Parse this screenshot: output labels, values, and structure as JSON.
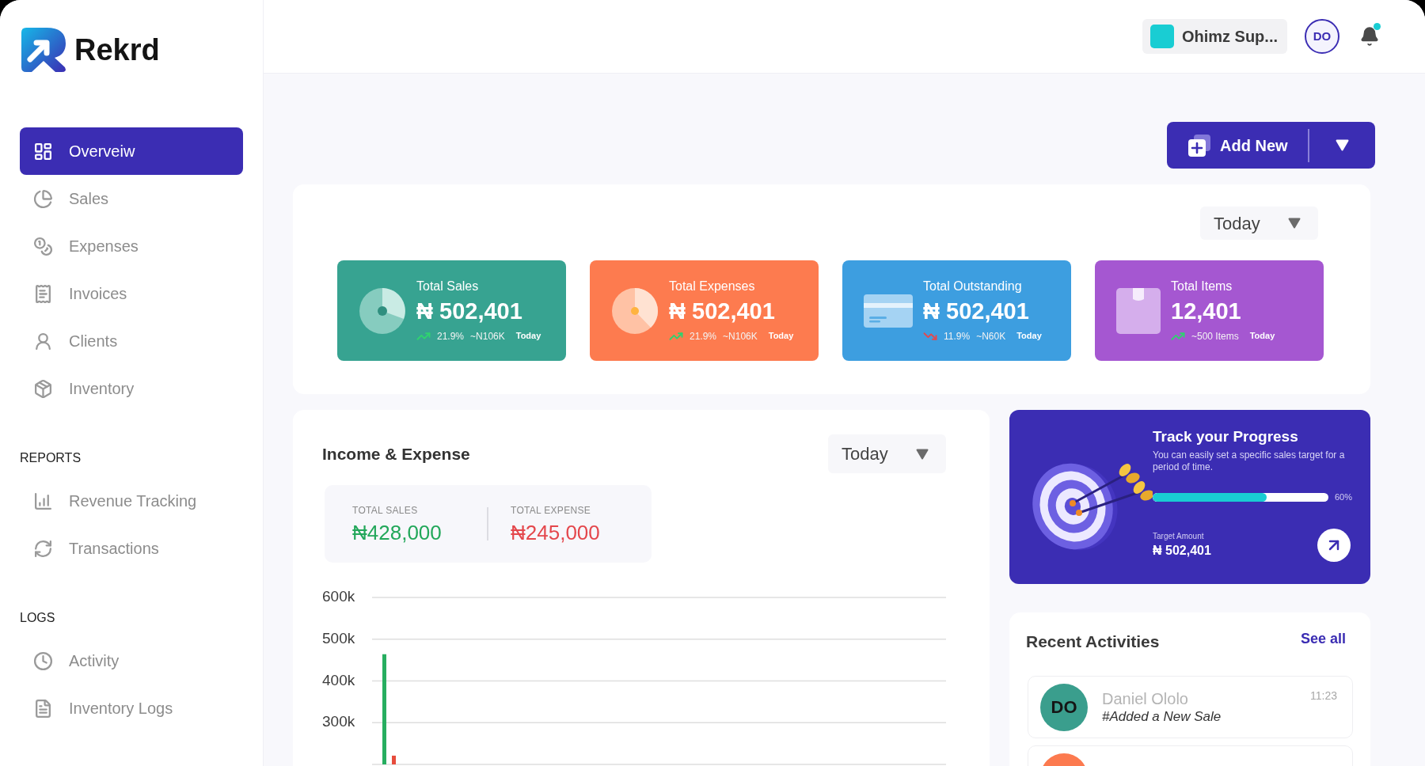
{
  "sidebar": {
    "brand": "Rekrd",
    "sections": [
      {
        "items": [
          {
            "label": "Overveiw",
            "selected": true
          },
          {
            "label": "Sales",
            "selected": false
          },
          {
            "label": "Expenses",
            "selected": false
          },
          {
            "label": "Invoices",
            "selected": false
          },
          {
            "label": "Clients",
            "selected": false
          },
          {
            "label": "Inventory",
            "selected": false
          }
        ]
      },
      {
        "heading": "REPORTS",
        "items": [
          {
            "label": "Revenue Tracking",
            "selected": false
          },
          {
            "label": "Transactions",
            "selected": false
          }
        ]
      },
      {
        "heading": "LOGS",
        "items": [
          {
            "label": "Activity",
            "selected": false
          },
          {
            "label": "Inventory Logs",
            "selected": false
          }
        ]
      }
    ]
  },
  "header": {
    "workspace": "Ohimz Sup...",
    "avatar": "DO",
    "notifications": {
      "unread": true
    }
  },
  "actions": {
    "add_button": "Add New"
  },
  "stats": {
    "period": "Today",
    "cards": [
      {
        "title": "Total Sales",
        "value": "₦ 502,401",
        "rising": true,
        "change": "21.9%",
        "delta": "~N106K",
        "period": "Today",
        "color": "#37a391"
      },
      {
        "title": "Total Expenses",
        "value": "₦ 502,401",
        "rising": true,
        "change": "21.9%",
        "delta": "~N106K",
        "period": "Today",
        "color": "#fd7b4f"
      },
      {
        "title": "Total Outstanding",
        "value": "₦ 502,401",
        "rising": false,
        "change": "11.9%",
        "delta": "~N60K",
        "period": "Today",
        "color": "#3d9ee0"
      },
      {
        "title": "Total Items",
        "value": "12,401",
        "rising": true,
        "delta": "~500 Items",
        "period": "Today",
        "color": "#a557d1"
      }
    ]
  },
  "income_expense": {
    "title": "Income & Expense",
    "period": "Today",
    "summary": [
      {
        "label": "TOTAL SALES",
        "value": "₦428,000",
        "color": "#22a75a"
      },
      {
        "label": "TOTAL EXPENSE",
        "value": "₦245,000",
        "color": "#e4474c"
      }
    ],
    "chart_data": {
      "type": "bar",
      "grid": true,
      "ylim": [
        200000,
        600000
      ],
      "yticks": [
        {
          "value": 600000,
          "label": "600k"
        },
        {
          "value": 500000,
          "label": "500k"
        },
        {
          "value": 400000,
          "label": "400k"
        },
        {
          "value": 300000,
          "label": "300k"
        }
      ],
      "series": [
        {
          "color": "#27ae60",
          "values": [
            464000
          ]
        },
        {
          "color": "#e74c3c",
          "values": [
            221000
          ]
        }
      ]
    }
  },
  "progress_card": {
    "title": "Track your Progress",
    "description": "You can easily set a specific sales target for a period of time.",
    "level": 0.65,
    "percent": "60%",
    "target_label": "Target Amount",
    "target_value": "₦ 502,401"
  },
  "recent_activities": {
    "title": "Recent Activities",
    "see_all": "See all",
    "items": [
      {
        "initials": "DO",
        "color": "#3a9e8d",
        "name": "Daniel Ololo",
        "action": "#Added a New Sale",
        "time": "11:23"
      },
      {
        "color": "#fc7a4f"
      }
    ]
  }
}
